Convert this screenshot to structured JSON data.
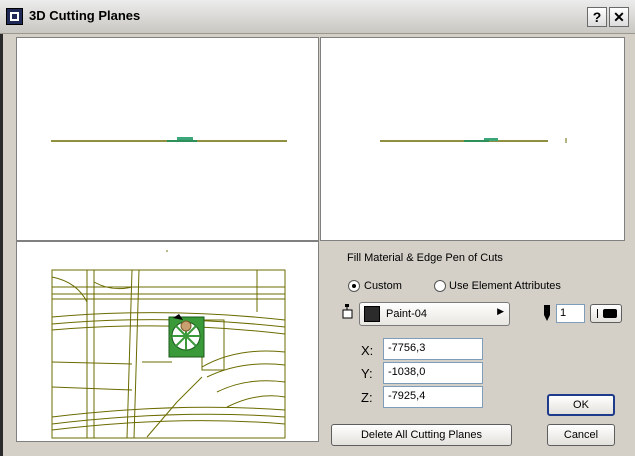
{
  "window": {
    "title": "3D Cutting Planes",
    "help_label": "?",
    "close_label": "✕"
  },
  "section": {
    "title": "Fill Material & Edge Pen of Cuts"
  },
  "radios": {
    "custom": "Custom",
    "use_element": "Use Element Attributes",
    "selected": "custom"
  },
  "material": {
    "name": "Paint-04",
    "swatch_color": "#2b2b2b",
    "arrow": "▶"
  },
  "pen": {
    "number": "1"
  },
  "coords": {
    "x_label": "X:",
    "x_value": "-7756,3",
    "y_label": "Y:",
    "y_value": "-1038,0",
    "z_label": "Z:",
    "z_value": "-7925,4"
  },
  "buttons": {
    "delete_all": "Delete All Cutting Planes",
    "ok": "OK",
    "cancel": "Cancel"
  },
  "colors": {
    "plan_line": "#6b6b00",
    "site_green": "#3a9a3a"
  }
}
